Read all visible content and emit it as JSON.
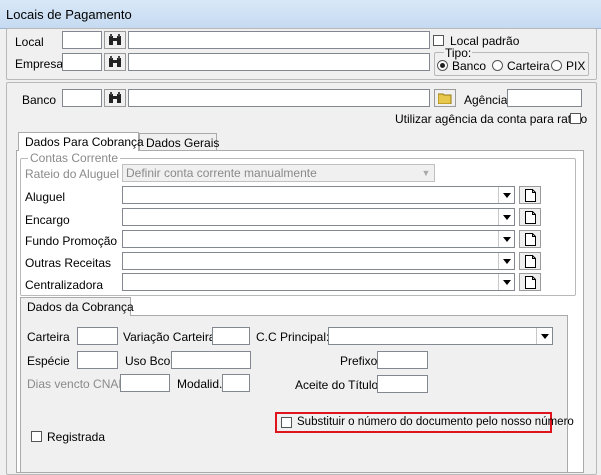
{
  "window": {
    "title": "Locais de Pagamento"
  },
  "top": {
    "local_label": "Local",
    "empresa_label": "Empresa",
    "local_padrao_label": "Local padrão",
    "tipo_label": "Tipo:",
    "tipo_options": [
      "Banco",
      "Carteira",
      "PIX"
    ],
    "tipo_selected": "Banco"
  },
  "banco": {
    "banco_label": "Banco",
    "agencia_label": "Agência",
    "utilizar_agencia_label": "Utilizar agência da conta para rateio"
  },
  "tabs": [
    {
      "label": "Dados Para Cobrança",
      "active": true
    },
    {
      "label": "Dados Gerais",
      "active": false
    }
  ],
  "contas_corrente": {
    "group_label": "Contas Corrente",
    "rateio_label": "Rateio do Aluguel",
    "rateio_value": "Definir conta corrente manualmente",
    "rows": [
      {
        "label": "Aluguel"
      },
      {
        "label": "Encargo"
      },
      {
        "label": "Fundo Promoção"
      },
      {
        "label": "Outras Receitas"
      },
      {
        "label": "Centralizadora"
      }
    ]
  },
  "cobranca_tab": {
    "label": "Dados da Cobrança"
  },
  "cobranca": {
    "carteira_label": "Carteira",
    "variacao_label": "Variação Carteira",
    "cc_principal_label": "C.C Principal:",
    "especie_label": "Espécie",
    "uso_bco_label": "Uso Bco",
    "prefixo_label": "Prefixo",
    "dias_vencto_label": "Dias vencto CNAB",
    "modalid_label": "Modalid.",
    "aceite_label": "Aceite do Título",
    "substituir_label": "Substituir o número do documento pelo nosso número",
    "registrada_label": "Registrada"
  },
  "colors": {
    "highlight": "#e0141c",
    "titlebar": "#c5daf1"
  },
  "icons": [
    "binoculars-icon",
    "folder-icon",
    "document-icon",
    "chevron-down-icon"
  ]
}
